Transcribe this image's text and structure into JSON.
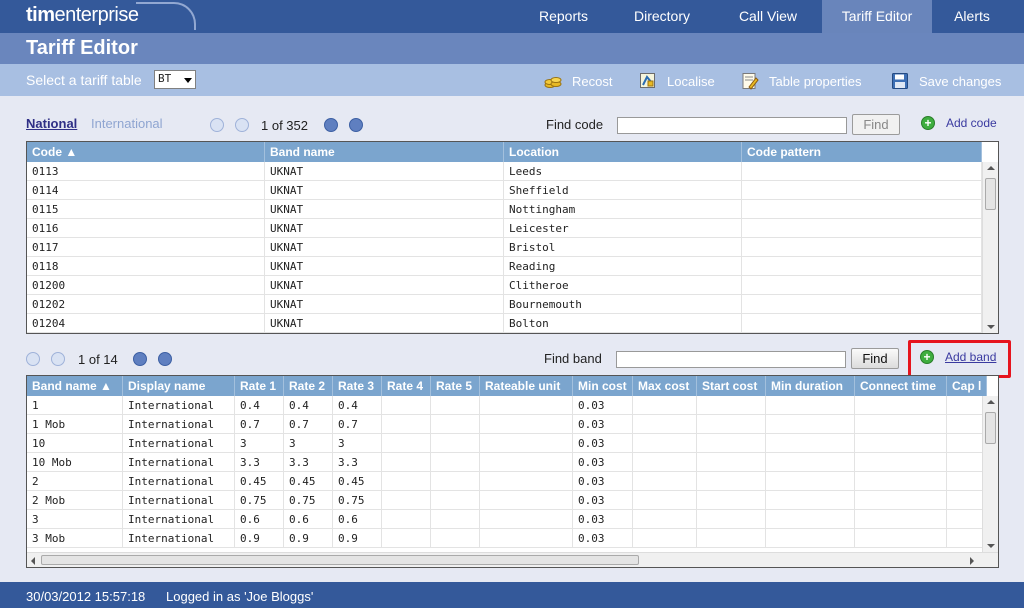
{
  "app": {
    "logo_bold": "tim",
    "logo_rest": "enterprise"
  },
  "nav": [
    {
      "label": "Reports",
      "active": false
    },
    {
      "label": "Directory",
      "active": false
    },
    {
      "label": "Call View",
      "active": false
    },
    {
      "label": "Tariff Editor",
      "active": true
    },
    {
      "label": "Alerts",
      "active": false
    }
  ],
  "page_title": "Tariff Editor",
  "toolbar": {
    "select_label": "Select a tariff table",
    "select_value": "BT",
    "actions": [
      {
        "label": "Recost",
        "icon": "coins-icon"
      },
      {
        "label": "Localise",
        "icon": "localise-icon"
      },
      {
        "label": "Table properties",
        "icon": "table-properties-icon"
      },
      {
        "label": "Save changes",
        "icon": "save-icon"
      }
    ]
  },
  "codes_section": {
    "tab_national": "National",
    "tab_international": "International",
    "pager_text": "1 of 352",
    "find_label": "Find code",
    "find_value": "",
    "find_button": "Find",
    "add_label": "Add code",
    "columns": [
      "Code ▲",
      "Band name",
      "Location",
      "Code pattern"
    ],
    "rows": [
      [
        "0113",
        "UKNAT",
        "Leeds",
        ""
      ],
      [
        "0114",
        "UKNAT",
        "Sheffield",
        ""
      ],
      [
        "0115",
        "UKNAT",
        "Nottingham",
        ""
      ],
      [
        "0116",
        "UKNAT",
        "Leicester",
        ""
      ],
      [
        "0117",
        "UKNAT",
        "Bristol",
        ""
      ],
      [
        "0118",
        "UKNAT",
        "Reading",
        ""
      ],
      [
        "01200",
        "UKNAT",
        "Clitheroe",
        ""
      ],
      [
        "01202",
        "UKNAT",
        "Bournemouth",
        ""
      ],
      [
        "01204",
        "UKNAT",
        "Bolton",
        ""
      ]
    ]
  },
  "bands_section": {
    "pager_text": "1 of 14",
    "find_label": "Find band",
    "find_value": "",
    "find_button": "Find",
    "add_label": "Add band",
    "columns": [
      "Band name ▲",
      "Display name",
      "Rate 1",
      "Rate 2",
      "Rate 3",
      "Rate 4",
      "Rate 5",
      "Rateable unit",
      "Min cost",
      "Max cost",
      "Start cost",
      "Min duration",
      "Connect time",
      "Cap l"
    ],
    "rows": [
      [
        "1",
        "International",
        "0.4",
        "0.4",
        "0.4",
        "",
        "",
        "",
        "0.03",
        "",
        "",
        "",
        "",
        ""
      ],
      [
        "1 Mob",
        "International",
        "0.7",
        "0.7",
        "0.7",
        "",
        "",
        "",
        "0.03",
        "",
        "",
        "",
        "",
        ""
      ],
      [
        "10",
        "International",
        "3",
        "3",
        "3",
        "",
        "",
        "",
        "0.03",
        "",
        "",
        "",
        "",
        ""
      ],
      [
        "10 Mob",
        "International",
        "3.3",
        "3.3",
        "3.3",
        "",
        "",
        "",
        "0.03",
        "",
        "",
        "",
        "",
        ""
      ],
      [
        "2",
        "International",
        "0.45",
        "0.45",
        "0.45",
        "",
        "",
        "",
        "0.03",
        "",
        "",
        "",
        "",
        ""
      ],
      [
        "2 Mob",
        "International",
        "0.75",
        "0.75",
        "0.75",
        "",
        "",
        "",
        "0.03",
        "",
        "",
        "",
        "",
        ""
      ],
      [
        "3",
        "International",
        "0.6",
        "0.6",
        "0.6",
        "",
        "",
        "",
        "0.03",
        "",
        "",
        "",
        "",
        ""
      ],
      [
        "3 Mob",
        "International",
        "0.9",
        "0.9",
        "0.9",
        "",
        "",
        "",
        "0.03",
        "",
        "",
        "",
        "",
        ""
      ]
    ]
  },
  "footer": {
    "datetime": "30/03/2012 15:57:18",
    "login_text": "Logged in as 'Joe Bloggs'"
  },
  "colors": {
    "nav_bg": "#34599a",
    "title_bg": "#6a86bd",
    "toolbar_bg": "#a8bfe2",
    "grid_header": "#7ba5ce",
    "highlight": "#e6141e"
  }
}
